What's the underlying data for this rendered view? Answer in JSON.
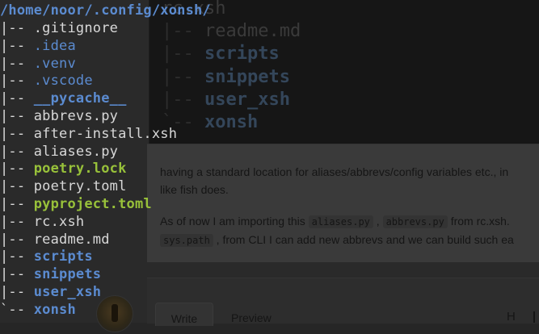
{
  "terminal": {
    "cwd_path": "/home/noor/.config/xonsh/",
    "entries": [
      {
        "prefix": "|-- ",
        "name": ".gitignore",
        "kind": "file"
      },
      {
        "prefix": "|-- ",
        "name": ".idea",
        "kind": "hidden"
      },
      {
        "prefix": "|-- ",
        "name": ".venv",
        "kind": "hidden"
      },
      {
        "prefix": "|-- ",
        "name": ".vscode",
        "kind": "hidden"
      },
      {
        "prefix": "|-- ",
        "name": "__pycache__",
        "kind": "dir"
      },
      {
        "prefix": "|-- ",
        "name": "abbrevs.py",
        "kind": "file"
      },
      {
        "prefix": "|-- ",
        "name": "after-install.xsh",
        "kind": "file"
      },
      {
        "prefix": "|-- ",
        "name": "aliases.py",
        "kind": "file"
      },
      {
        "prefix": "|-- ",
        "name": "poetry.lock",
        "kind": "green"
      },
      {
        "prefix": "|-- ",
        "name": "poetry.toml",
        "kind": "file"
      },
      {
        "prefix": "|-- ",
        "name": "pyproject.toml",
        "kind": "green"
      },
      {
        "prefix": "|-- ",
        "name": "rc.xsh",
        "kind": "file"
      },
      {
        "prefix": "|-- ",
        "name": "readme.md",
        "kind": "file"
      },
      {
        "prefix": "|-- ",
        "name": "scripts",
        "kind": "dir"
      },
      {
        "prefix": "|-- ",
        "name": "snippets",
        "kind": "dir"
      },
      {
        "prefix": "|-- ",
        "name": "user_xsh",
        "kind": "dir"
      },
      {
        "prefix": "`-- ",
        "name": "xonsh",
        "kind": "dir"
      }
    ]
  },
  "background_terminal": {
    "lines": [
      {
        "prefix": "",
        "name": "rc.xsh",
        "kind": "file"
      },
      {
        "prefix": "|-- ",
        "name": "readme.md",
        "kind": "file"
      },
      {
        "prefix": "|-- ",
        "name": "scripts",
        "kind": "dir"
      },
      {
        "prefix": "|-- ",
        "name": "snippets",
        "kind": "dir"
      },
      {
        "prefix": "|-- ",
        "name": "user_xsh",
        "kind": "dir"
      },
      {
        "prefix": "`-- ",
        "name": "xonsh",
        "kind": "dir"
      }
    ]
  },
  "comment": {
    "line1": "having a standard location for aliases/abbrevs/config variables etc., in",
    "line2": "like fish does.",
    "line3_start": "As of now I am importing this ",
    "code1": "aliases.py",
    "sep": " , ",
    "code2": "abbrevs.py",
    "line3_end": " from rc.xsh.",
    "code3": "sys.path",
    "line4_end": " , from CLI I can add new abbrevs and we can build such ea"
  },
  "editor": {
    "tab_write": "Write",
    "tab_preview": "Preview",
    "tool_heading": "H"
  },
  "colors": {
    "dir": "#5b8bd0",
    "green": "#98c13a",
    "file": "#d8d8d8"
  }
}
